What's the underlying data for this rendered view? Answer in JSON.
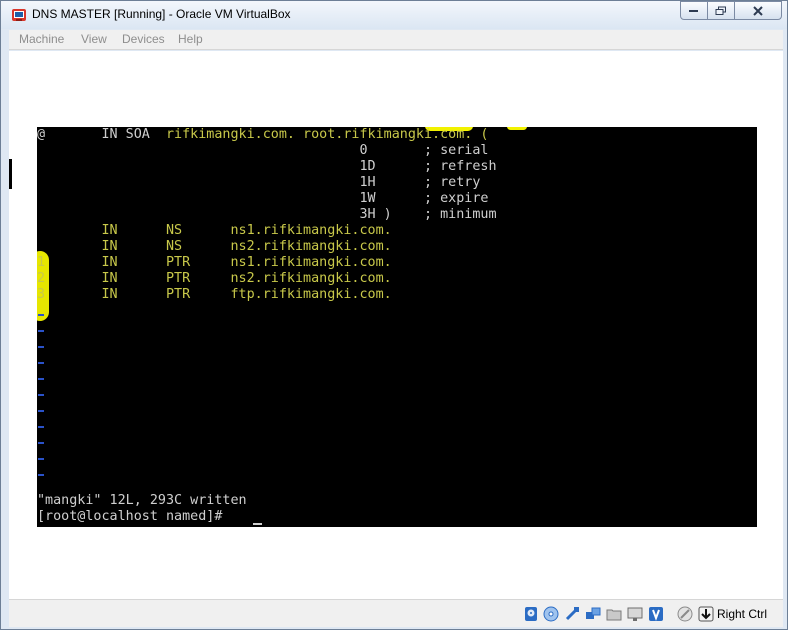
{
  "window": {
    "title": "DNS MASTER [Running] - Oracle VM VirtualBox"
  },
  "menu": {
    "items": [
      "Machine",
      "View",
      "Devices",
      "Help"
    ]
  },
  "terminal": {
    "lines": [
      {
        "segments": [
          {
            "t": "@       IN SOA  ",
            "c": "w"
          },
          {
            "t": "rifkimangki.com. root.rifkimangki.com. (",
            "c": "y"
          }
        ]
      },
      {
        "segments": [
          {
            "t": "                                        0       ; serial",
            "c": "w"
          }
        ]
      },
      {
        "segments": [
          {
            "t": "                                        1D      ; refresh",
            "c": "w"
          }
        ]
      },
      {
        "segments": [
          {
            "t": "                                        1H      ; retry",
            "c": "w"
          }
        ]
      },
      {
        "segments": [
          {
            "t": "                                        1W      ; expire",
            "c": "w"
          }
        ]
      },
      {
        "segments": [
          {
            "t": "                                        3H )    ; minimum",
            "c": "w"
          }
        ]
      },
      {
        "segments": [
          {
            "t": "        IN      NS      ns1.rifkimangki.com.",
            "c": "y"
          }
        ]
      },
      {
        "segments": [
          {
            "t": "        IN      NS      ns2.rifkimangki.com.",
            "c": "y"
          }
        ]
      },
      {
        "segments": [
          {
            "t": "1       IN      PTR     ns1.rifkimangki.com.",
            "c": "y"
          }
        ]
      },
      {
        "segments": [
          {
            "t": "2       IN      PTR     ns2.rifkimangki.com.",
            "c": "y"
          }
        ]
      },
      {
        "segments": [
          {
            "t": "3       IN      PTR     ftp.rifkimangki.com.",
            "c": "y"
          }
        ]
      }
    ],
    "empty_line_markers": 11,
    "status_message": "\"mangki\" 12L, 293C written",
    "prompt": "[root@localhost named]# ",
    "cursor": "_"
  },
  "statusbar": {
    "icons": [
      "hard-disk-icon",
      "optical-drive-icon",
      "usb-icon",
      "network-icon",
      "shared-folders-icon",
      "display-icon",
      "video-capture-icon",
      "mouse-integration-icon",
      "keyboard-capture-icon"
    ],
    "host_key": "Right Ctrl"
  },
  "colors": {
    "terminal_bg": "#000000",
    "terminal_text": "#cfcfcf",
    "terminal_yellow": "#c8c84a",
    "tilde_blue": "#2a52c9",
    "highlight": "#f2f200"
  }
}
